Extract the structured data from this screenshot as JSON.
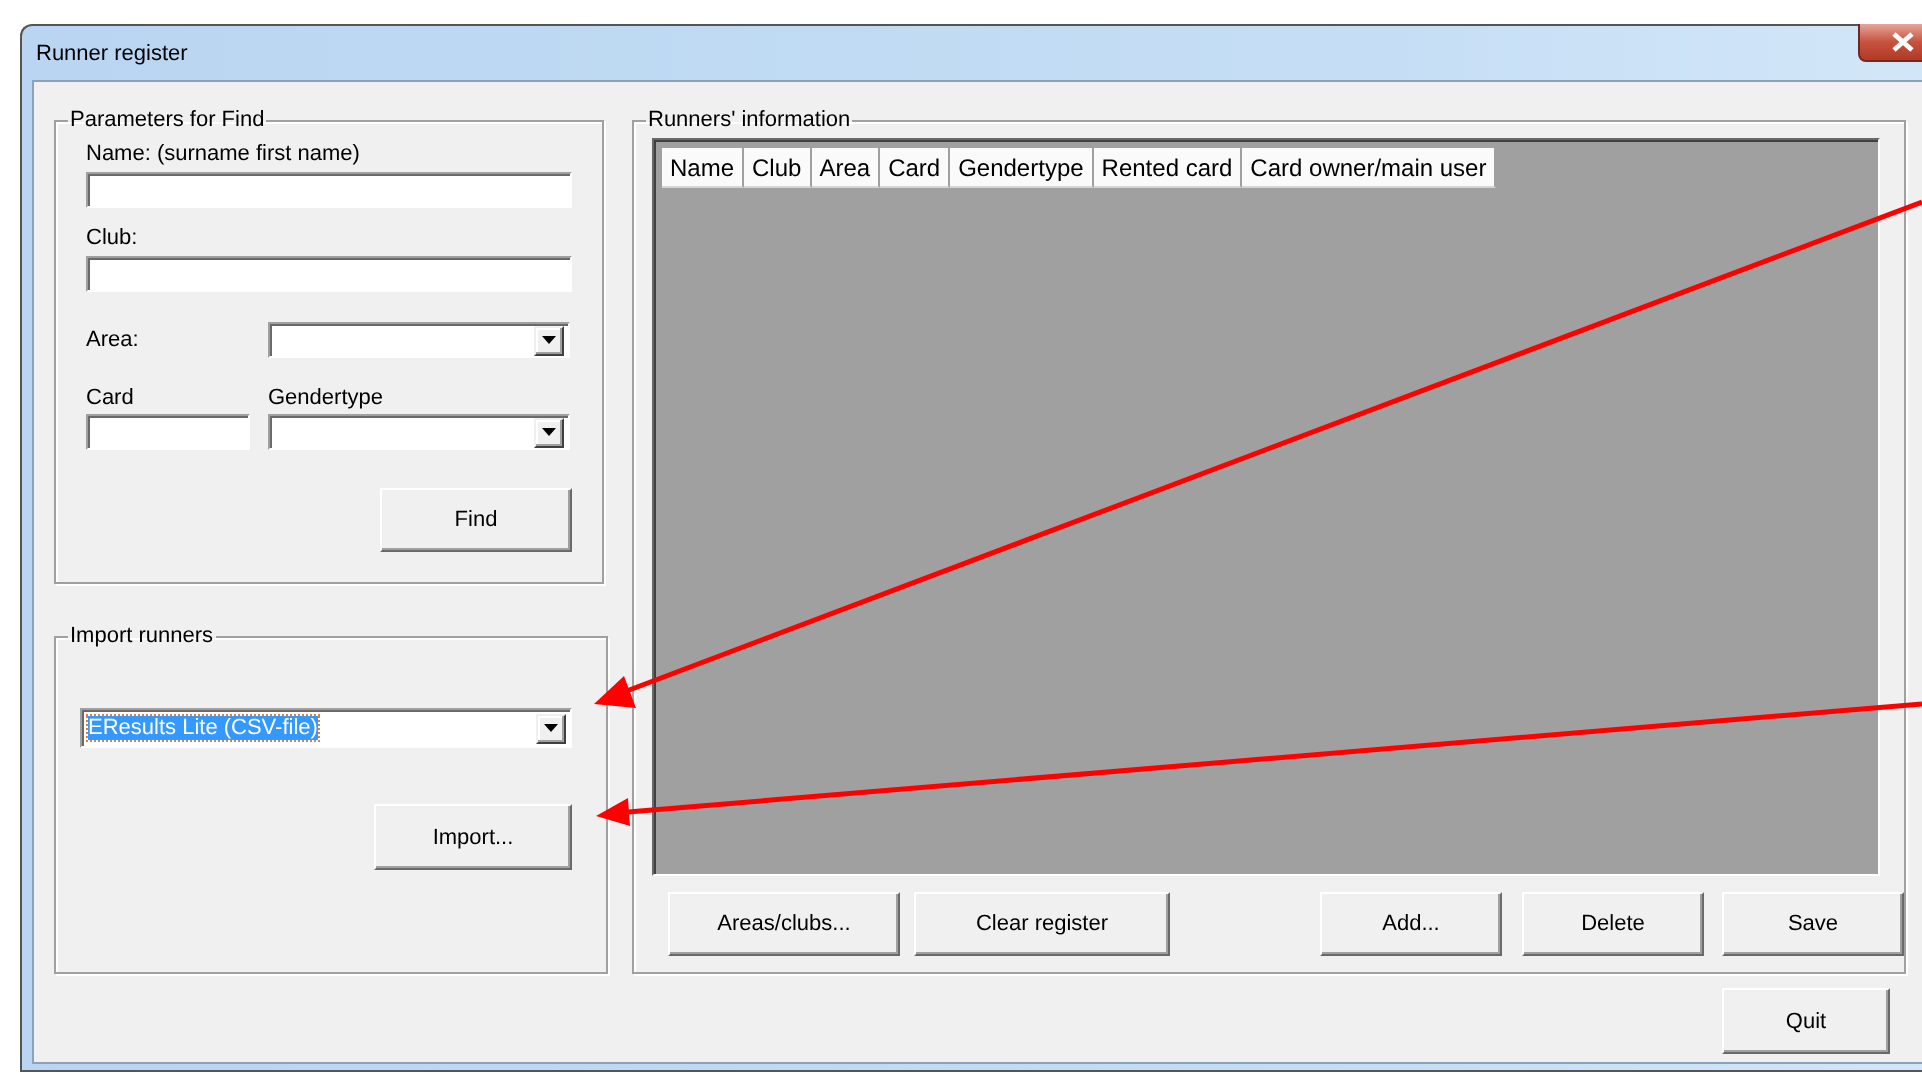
{
  "window": {
    "title": "Runner register"
  },
  "find": {
    "title": "Parameters for Find",
    "fields": [
      {
        "label": "Name: (surname first name)",
        "kind": "text"
      },
      {
        "label": "Club:",
        "kind": "text"
      },
      {
        "label": "Area:",
        "kind": "combo"
      },
      {
        "label": "Card",
        "kind": "text"
      },
      {
        "label": "Gendertype",
        "kind": "combo"
      }
    ],
    "button": "Find"
  },
  "import": {
    "title": "Import runners",
    "combo": {
      "value": "EResults Lite (CSV-file)",
      "selected": true
    },
    "button": "Import..."
  },
  "runners": {
    "title": "Runners' information",
    "columns": [
      "Name",
      "Club",
      "Area",
      "Card",
      "Gendertype",
      "Rented card",
      "Card owner/main user"
    ],
    "buttons": [
      "Areas/clubs...",
      "Clear register",
      "Add...",
      "Delete",
      "Save"
    ]
  },
  "quit": "Quit"
}
